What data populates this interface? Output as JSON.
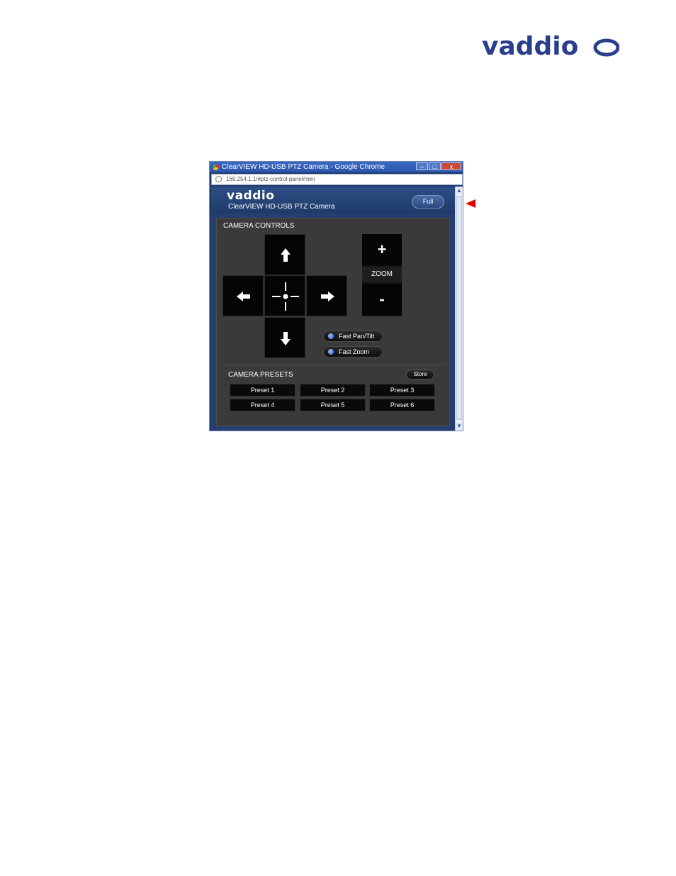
{
  "page": {
    "logo_text": "vaddio"
  },
  "browser": {
    "title": "ClearVIEW HD-USB PTZ Camera - Google Chrome",
    "url": "169.254.1.1/#ptz-control-panel/mini",
    "minimize_glyph": "–",
    "maximize_glyph": "□",
    "close_glyph": "x"
  },
  "app": {
    "logo_text": "vaddio",
    "subtitle": "ClearVIEW HD-USB PTZ Camera",
    "full_button": "Full"
  },
  "controls": {
    "title": "CAMERA CONTROLS",
    "zoom_in": "+",
    "zoom_label": "ZOOM",
    "zoom_out": "-",
    "fast_pan_tilt": "Fast Pan/Tilt",
    "fast_zoom": "Fast Zoom"
  },
  "presets": {
    "title": "CAMERA PRESETS",
    "store": "Store",
    "items": [
      "Preset 1",
      "Preset 2",
      "Preset 3",
      "Preset 4",
      "Preset 5",
      "Preset 6"
    ]
  },
  "icons": {
    "up": "arrow-up-icon",
    "down": "arrow-down-icon",
    "left": "arrow-left-icon",
    "right": "arrow-right-icon",
    "home": "crosshair-home-icon",
    "pointer": "red-pointer-arrow-icon"
  },
  "colors": {
    "brand_blue": "#2a3f8c",
    "header_blue": "#243f70",
    "panel_gray": "#3a3a3a",
    "pointer_red": "#e00000"
  }
}
